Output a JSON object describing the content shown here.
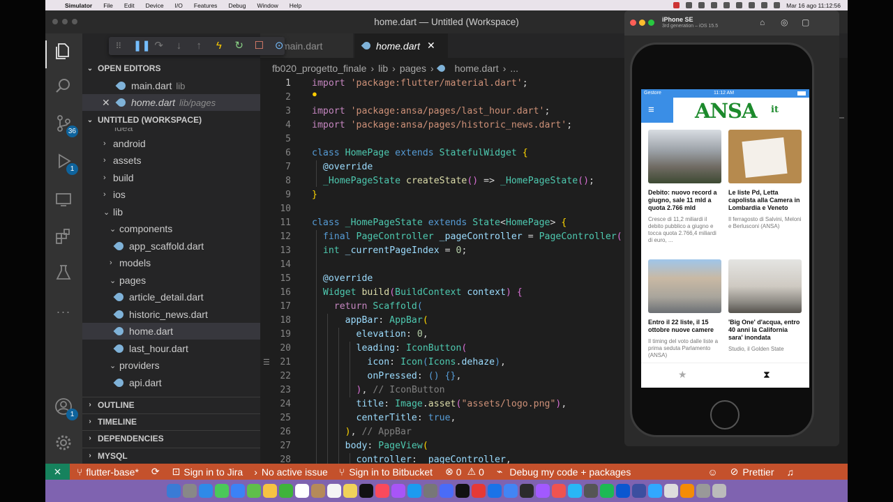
{
  "menubar": {
    "app": "Simulator",
    "items": [
      "File",
      "Edit",
      "Device",
      "I/O",
      "Features",
      "Debug",
      "Window",
      "Help"
    ],
    "clock": "Mar 16 ago  11:12:56"
  },
  "window": {
    "title": "home.dart — Untitled (Workspace)"
  },
  "activity": {
    "source_control_badge": "36",
    "debug_badge": "1",
    "accounts_badge": "1"
  },
  "sidebar": {
    "open_editors_header": "OPEN EDITORS",
    "open_editors": [
      {
        "name": "main.dart",
        "path": "lib"
      },
      {
        "name": "home.dart",
        "path": "lib/pages"
      }
    ],
    "workspace_header": "UNTITLED (WORKSPACE)",
    "tree": [
      {
        "label": "idea"
      },
      {
        "label": "android"
      },
      {
        "label": "assets"
      },
      {
        "label": "build"
      },
      {
        "label": "ios"
      },
      {
        "label": "lib"
      },
      {
        "label": "components"
      },
      {
        "label": "app_scaffold.dart"
      },
      {
        "label": "models"
      },
      {
        "label": "pages"
      },
      {
        "label": "article_detail.dart"
      },
      {
        "label": "historic_news.dart"
      },
      {
        "label": "home.dart"
      },
      {
        "label": "last_hour.dart"
      },
      {
        "label": "providers"
      },
      {
        "label": "api.dart"
      }
    ],
    "sections": [
      "OUTLINE",
      "TIMELINE",
      "DEPENDENCIES",
      "MYSQL"
    ]
  },
  "tabs": [
    {
      "label": "main.dart"
    },
    {
      "label": "home.dart"
    }
  ],
  "breadcrumb": [
    "fb020_progetto_finale",
    "lib",
    "pages",
    "home.dart",
    "..."
  ],
  "code_lines": [
    "1",
    "2",
    "3",
    "4",
    "5",
    "6",
    "7",
    "8",
    "9",
    "10",
    "11",
    "12",
    "13",
    "14",
    "15",
    "16",
    "17",
    "18",
    "19",
    "20",
    "21",
    "22",
    "23",
    "24",
    "25",
    "26",
    "27",
    "28"
  ],
  "simulator": {
    "device": "iPhone SE",
    "device_sub": "3rd generation – iOS 15.5",
    "carrier": "Gestore",
    "time": "11:12 AM",
    "logo": "ANSA",
    "logo_suffix": "it",
    "articles": [
      {
        "title": "Debito: nuovo record a giugno, sale 11 mld a quota 2.766 mld",
        "summary": "Cresce di 11,2 miliardi il debito pubblico a giugno e tocca quota 2.766,4 miliardi di euro, ...",
        "image": "building-photo"
      },
      {
        "title": "Le liste Pd, Letta capolista alla Camera in Lombardia e Veneto",
        "summary": "Il ferragosto di Salvini, Meloni e Berlusconi (ANSA)",
        "image": "pd-logo-photo"
      },
      {
        "title": "Entro il 22 liste, il 15 ottobre nuove camere",
        "summary": "Il timing del voto dalle liste a prima seduta Parlamento (ANSA)",
        "image": "palace-photo"
      },
      {
        "title": "'Big One' d'acqua, entro 40 anni la California sara' inondata",
        "summary": "Studio, il Golden State",
        "image": "statue-photo"
      }
    ]
  },
  "statusbar": {
    "branch": "flutter-base*",
    "jira": "Sign in to Jira",
    "issue": "No active issue",
    "bitbucket": "Sign in to Bitbucket",
    "errors": "0",
    "warnings": "0",
    "debug": "Debug my code + packages",
    "prettier": "Prettier"
  },
  "colors": {
    "statusbar": "#c4512c",
    "accent": "#0e639c",
    "ansa_green": "#1c8a2c",
    "appbar": "#3a8ee6"
  }
}
